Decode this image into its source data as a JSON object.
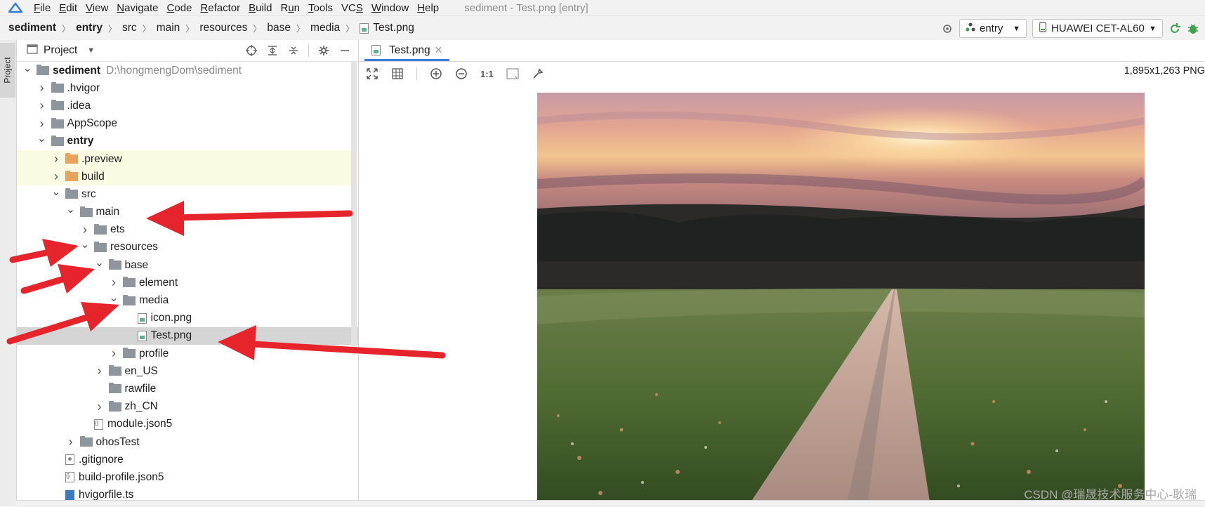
{
  "menubar": {
    "items": [
      {
        "pre": "",
        "u": "F",
        "post": "ile"
      },
      {
        "pre": "",
        "u": "E",
        "post": "dit"
      },
      {
        "pre": "",
        "u": "V",
        "post": "iew"
      },
      {
        "pre": "",
        "u": "N",
        "post": "avigate"
      },
      {
        "pre": "",
        "u": "C",
        "post": "ode"
      },
      {
        "pre": "",
        "u": "R",
        "post": "efactor"
      },
      {
        "pre": "",
        "u": "B",
        "post": "uild"
      },
      {
        "pre": "R",
        "u": "u",
        "post": "n"
      },
      {
        "pre": "",
        "u": "T",
        "post": "ools"
      },
      {
        "pre": "VC",
        "u": "S",
        "post": ""
      },
      {
        "pre": "",
        "u": "W",
        "post": "indow"
      },
      {
        "pre": "",
        "u": "H",
        "post": "elp"
      }
    ],
    "window_title": "sediment - Test.png [entry]"
  },
  "breadcrumb": [
    "sediment",
    "entry",
    "src",
    "main",
    "resources",
    "base",
    "media",
    "Test.png"
  ],
  "toolbar": {
    "run_config": "entry",
    "device": "HUAWEI CET-AL60"
  },
  "project_panel": {
    "title": "Project",
    "side_tab": "Project",
    "tree": [
      {
        "label": "sediment",
        "path": "D:\\hongmengDom\\sediment",
        "depth": 0,
        "chevron": "open",
        "icon": "folder-module",
        "bold": true
      },
      {
        "label": ".hvigor",
        "depth": 1,
        "chevron": "closed",
        "icon": "folder"
      },
      {
        "label": ".idea",
        "depth": 1,
        "chevron": "closed",
        "icon": "folder"
      },
      {
        "label": "AppScope",
        "depth": 1,
        "chevron": "closed",
        "icon": "folder"
      },
      {
        "label": "entry",
        "depth": 1,
        "chevron": "open",
        "icon": "folder-module",
        "bold": true
      },
      {
        "label": ".preview",
        "depth": 2,
        "chevron": "closed",
        "icon": "folder-orange",
        "highlight": true
      },
      {
        "label": "build",
        "depth": 2,
        "chevron": "closed",
        "icon": "folder-orange",
        "highlight": true
      },
      {
        "label": "src",
        "depth": 2,
        "chevron": "open",
        "icon": "folder"
      },
      {
        "label": "main",
        "depth": 3,
        "chevron": "open",
        "icon": "folder"
      },
      {
        "label": "ets",
        "depth": 4,
        "chevron": "closed",
        "icon": "folder"
      },
      {
        "label": "resources",
        "depth": 4,
        "chevron": "open",
        "icon": "folder"
      },
      {
        "label": "base",
        "depth": 5,
        "chevron": "open",
        "icon": "folder"
      },
      {
        "label": "element",
        "depth": 6,
        "chevron": "closed",
        "icon": "folder"
      },
      {
        "label": "media",
        "depth": 6,
        "chevron": "open",
        "icon": "folder"
      },
      {
        "label": "icon.png",
        "depth": 7,
        "chevron": "none",
        "icon": "image-file"
      },
      {
        "label": "Test.png",
        "depth": 7,
        "chevron": "none",
        "icon": "image-file",
        "selected": true
      },
      {
        "label": "profile",
        "depth": 6,
        "chevron": "closed",
        "icon": "folder"
      },
      {
        "label": "en_US",
        "depth": 5,
        "chevron": "closed",
        "icon": "folder"
      },
      {
        "label": "rawfile",
        "depth": 5,
        "chevron": "none",
        "icon": "folder"
      },
      {
        "label": "zh_CN",
        "depth": 5,
        "chevron": "closed",
        "icon": "folder"
      },
      {
        "label": "module.json5",
        "depth": 4,
        "chevron": "none",
        "icon": "json-file"
      },
      {
        "label": "ohosTest",
        "depth": 3,
        "chevron": "closed",
        "icon": "folder"
      },
      {
        "label": ".gitignore",
        "depth": 2,
        "chevron": "none",
        "icon": "git-file"
      },
      {
        "label": "build-profile.json5",
        "depth": 2,
        "chevron": "none",
        "icon": "json-file"
      },
      {
        "label": "hvigorfile.ts",
        "depth": 2,
        "chevron": "none",
        "icon": "ts-file"
      }
    ]
  },
  "editor": {
    "tab_label": "Test.png",
    "image_info": "1,895x1,263 PNG",
    "zoom_label": "1:1"
  },
  "watermark": "CSDN @瑞晟技术服务中心-耿瑞",
  "colors": {
    "accent": "#3f7ed8",
    "arrow": "#e5242b",
    "selected_row": "#d5d5d5",
    "highlight_row": "#fbfbe3"
  }
}
